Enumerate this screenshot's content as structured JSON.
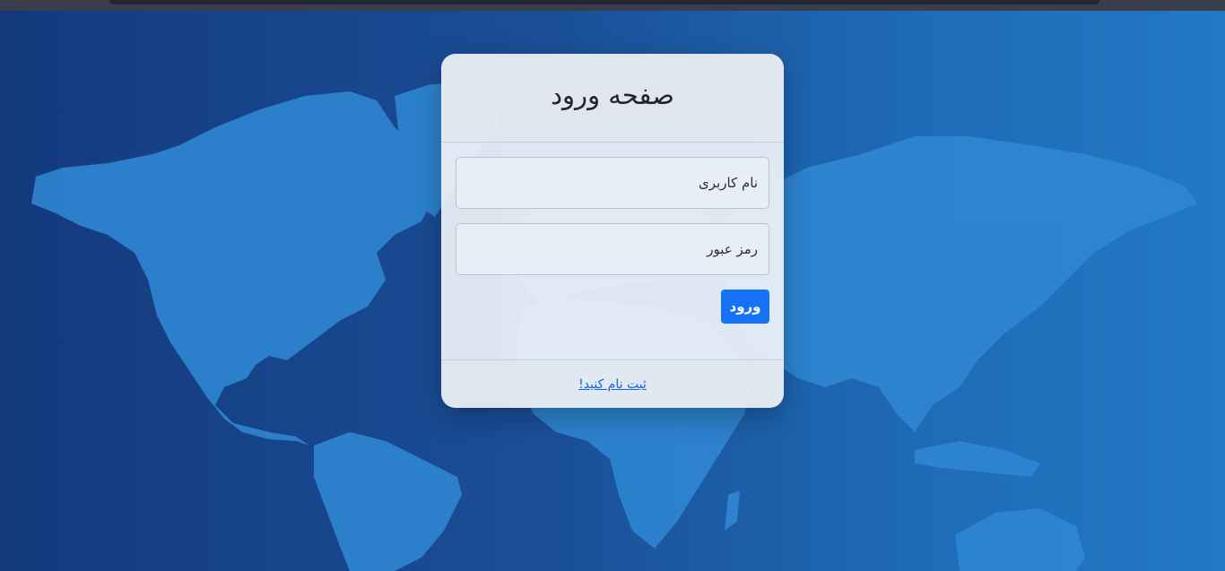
{
  "colors": {
    "background_dark": "#14397d",
    "background_light": "#2279c4",
    "continents": "#2f86d2",
    "primary_button": "#1671f4",
    "link": "#1664d8"
  },
  "login": {
    "title": "صفحه ورود",
    "username_placeholder": "نام کاربری",
    "password_placeholder": "رمز عبور",
    "submit_label": "ورود",
    "register_link": "ثبت نام کنید!"
  }
}
